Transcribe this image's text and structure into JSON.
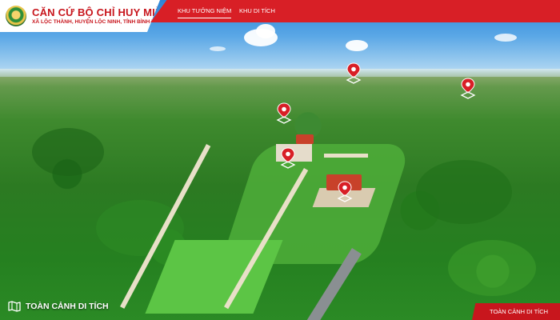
{
  "brand": {
    "title": "CĂN CỨ BỘ CHỈ HUY MIỀN",
    "subtitle": "XÃ LỘC THÀNH, HUYỆN LỘC NINH, TỈNH BÌNH PHƯỚC",
    "logo_icon": "emblem-icon"
  },
  "nav": {
    "items": [
      {
        "label": "KHU TƯỞNG NIỆM",
        "active": true
      },
      {
        "label": "KHU DI TÍCH",
        "active": false
      }
    ]
  },
  "hotspots": [
    {
      "icon": "map-pin-icon"
    },
    {
      "icon": "map-pin-icon"
    },
    {
      "icon": "map-pin-icon"
    },
    {
      "icon": "map-pin-icon"
    },
    {
      "icon": "map-pin-icon"
    }
  ],
  "footer": {
    "left_label": "TOÀN CẢNH DI TÍCH",
    "left_icon": "map-icon",
    "right_label": "TOÀN CẢNH DI TÍCH"
  },
  "colors": {
    "brand_red": "#d81f26",
    "title_red": "#c8161d",
    "white": "#ffffff"
  }
}
